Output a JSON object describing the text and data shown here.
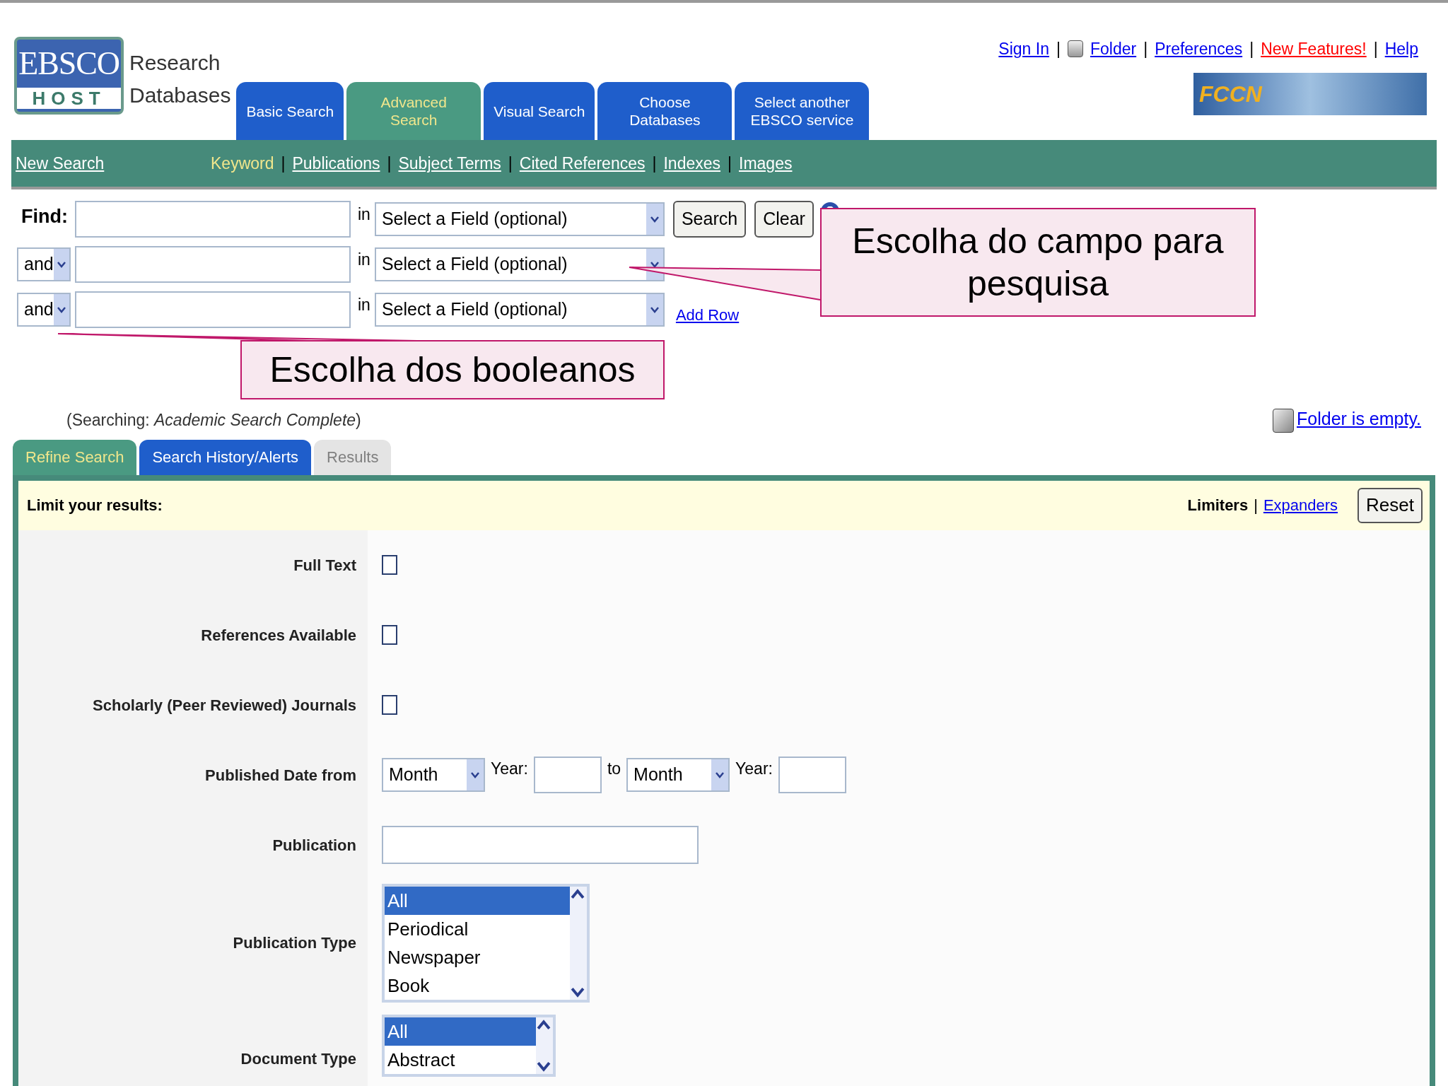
{
  "logo": {
    "brand": "EBSCO",
    "sub": "HOST",
    "line1": "Research",
    "line2": "Databases"
  },
  "top_links": [
    {
      "label": "Sign In",
      "kind": "link"
    },
    {
      "label": "Folder",
      "kind": "folder"
    },
    {
      "label": "Preferences",
      "kind": "link"
    },
    {
      "label": "New Features!",
      "kind": "highlight"
    },
    {
      "label": "Help",
      "kind": "link"
    }
  ],
  "top_separators": [
    "|",
    "|",
    "|",
    "|"
  ],
  "banner": {
    "text": "FCCN"
  },
  "main_tabs": [
    {
      "label": "Basic Search",
      "selected": false
    },
    {
      "label": "Advanced Search",
      "selected": true
    },
    {
      "label": "Visual Search",
      "selected": false
    },
    {
      "label": "Choose Databases",
      "selected": false
    },
    {
      "label": "Select another EBSCO service",
      "selected": false
    }
  ],
  "sub_nav": {
    "new_search": "New Search",
    "separators": [
      "|",
      "|",
      "|",
      "|",
      "|"
    ],
    "links": [
      {
        "label": "Keyword",
        "selected": true
      },
      {
        "label": "Publications",
        "selected": false
      },
      {
        "label": "Subject Terms",
        "selected": false
      },
      {
        "label": "Cited References",
        "selected": false
      },
      {
        "label": "Indexes",
        "selected": false
      },
      {
        "label": "Images",
        "selected": false
      }
    ]
  },
  "search_rows": [
    {
      "kind": "find",
      "label": "Find:",
      "in": "in",
      "field": "Select a Field (optional)"
    },
    {
      "kind": "bool",
      "operator": "and",
      "in": "in",
      "field": "Select a Field (optional)"
    },
    {
      "kind": "bool",
      "operator": "and",
      "in": "in",
      "field": "Select a Field (optional)"
    }
  ],
  "buttons": [
    "Search",
    "Clear"
  ],
  "add_row": "Add Row",
  "searching": "(Searching: *Academic Search Complete*)",
  "folder_status": "Folder is empty.",
  "lower_tabs": [
    {
      "label": "Refine Search",
      "selected": true,
      "disabled": false
    },
    {
      "label": "Search History/Alerts",
      "selected": false,
      "disabled": false
    },
    {
      "label": "Results",
      "selected": false,
      "disabled": true
    }
  ],
  "limits": {
    "title": "Limit your results:",
    "limiters": "Limiters",
    "separator": "|",
    "expanders": "Expanders",
    "reset": "Reset"
  },
  "limiters": [
    {
      "kind": "checkbox",
      "label": "Full Text",
      "checked": false
    },
    {
      "kind": "checkbox",
      "label": "References Available",
      "checked": false
    },
    {
      "kind": "checkbox",
      "label": "Scholarly (Peer Reviewed) Journals",
      "checked": false
    },
    {
      "kind": "date",
      "label": "Published Date from",
      "month": "Month",
      "year": "Year:",
      "to": "to",
      "month2": "Month",
      "year2": "Year:"
    },
    {
      "kind": "text",
      "label": "Publication"
    },
    {
      "kind": "listbox",
      "label": "Publication Type",
      "options": [
        {
          "label": "All",
          "selected": true
        },
        {
          "label": "Periodical",
          "selected": false
        },
        {
          "label": "Newspaper",
          "selected": false
        },
        {
          "label": "Book",
          "selected": false
        }
      ]
    },
    {
      "kind": "listbox",
      "label": "Document Type",
      "options": [
        {
          "label": "All",
          "selected": true
        },
        {
          "label": "Abstract",
          "selected": false
        }
      ]
    }
  ],
  "callouts": [
    {
      "text": "Escolha do campo para pesquisa"
    },
    {
      "text": "Escolha dos booleanos"
    }
  ]
}
